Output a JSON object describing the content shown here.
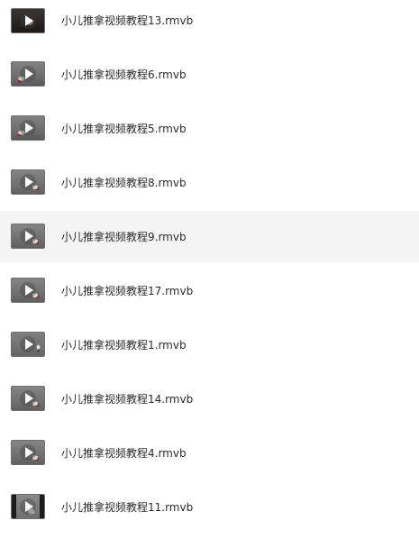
{
  "files": [
    {
      "name": "小儿推拿视频教程13.rmvb",
      "thumbnail_icon": "video-thumbnail-icon",
      "thumbnail_style": "dark",
      "highlighted": false
    },
    {
      "name": "小儿推拿视频教程6.rmvb",
      "thumbnail_icon": "video-thumbnail-icon",
      "thumbnail_style": "v2",
      "highlighted": false
    },
    {
      "name": "小儿推拿视频教程5.rmvb",
      "thumbnail_icon": "video-thumbnail-icon",
      "thumbnail_style": "v2",
      "highlighted": false
    },
    {
      "name": "小儿推拿视频教程8.rmvb",
      "thumbnail_icon": "video-thumbnail-icon",
      "thumbnail_style": "v1",
      "highlighted": false
    },
    {
      "name": "小儿推拿视频教程9.rmvb",
      "thumbnail_icon": "video-thumbnail-icon",
      "thumbnail_style": "v1",
      "highlighted": true
    },
    {
      "name": "小儿推拿视频教程17.rmvb",
      "thumbnail_icon": "video-thumbnail-icon",
      "thumbnail_style": "v1",
      "highlighted": false
    },
    {
      "name": "小儿推拿视频教程1.rmvb",
      "thumbnail_icon": "video-thumbnail-icon",
      "thumbnail_style": "v3",
      "highlighted": false
    },
    {
      "name": "小儿推拿视频教程14.rmvb",
      "thumbnail_icon": "video-thumbnail-icon",
      "thumbnail_style": "v1",
      "highlighted": false
    },
    {
      "name": "小儿推拿视频教程4.rmvb",
      "thumbnail_icon": "video-thumbnail-icon",
      "thumbnail_style": "v1",
      "highlighted": false
    },
    {
      "name": "小儿推拿视频教程11.rmvb",
      "thumbnail_icon": "video-thumbnail-icon",
      "thumbnail_style": "bw",
      "highlighted": false
    }
  ],
  "colors": {
    "highlight_row": "#f4f4f4",
    "text": "#2b2b2b",
    "background": "#ffffff"
  }
}
